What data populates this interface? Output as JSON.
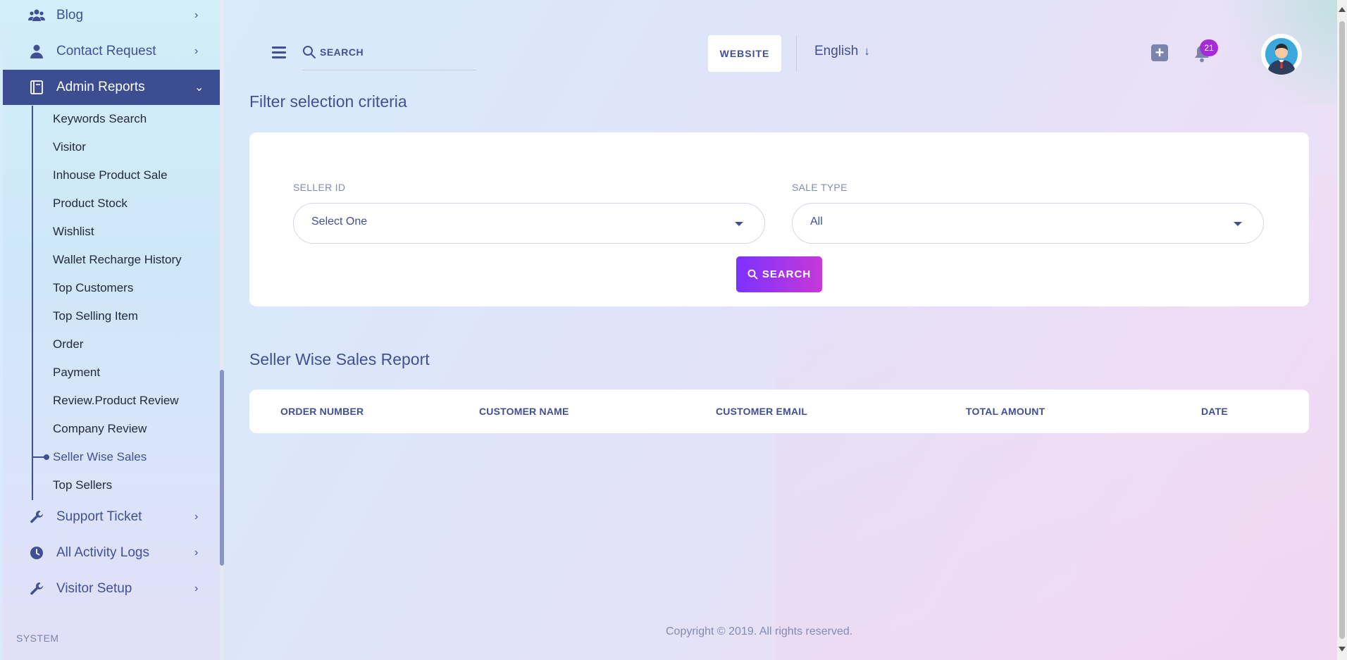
{
  "sidebar": {
    "top_items": [
      {
        "label": "Blog",
        "icon": "users-icon"
      },
      {
        "label": "Contact Request",
        "icon": "user-icon"
      },
      {
        "label": "Admin Reports",
        "icon": "book-icon"
      }
    ],
    "sub_items": [
      "Keywords Search",
      "Visitor",
      "Inhouse Product Sale",
      "Product Stock",
      "Wishlist",
      "Wallet Recharge History",
      "Top Customers",
      "Top Selling Item",
      "Order",
      "Payment",
      "Review.Product Review",
      "Company Review",
      "Seller Wise Sales",
      "Top Sellers"
    ],
    "active_sub_item": "Seller Wise Sales",
    "bottom_items": [
      {
        "label": "Support Ticket",
        "icon": "wrench-icon"
      },
      {
        "label": "All Activity Logs",
        "icon": "clock-icon"
      },
      {
        "label": "Visitor Setup",
        "icon": "wrench-icon"
      }
    ],
    "section_label": "SYSTEM"
  },
  "header": {
    "search_placeholder": "SEARCH",
    "website_label": "WEBSITE",
    "language": "English",
    "notification_count": "21"
  },
  "filter": {
    "title": "Filter selection criteria",
    "seller_label": "SELLER ID",
    "seller_value": "Select One",
    "sale_type_label": "SALE TYPE",
    "sale_type_value": "All",
    "search_button": "SEARCH"
  },
  "report": {
    "title": "Seller Wise Sales Report",
    "columns": [
      "ORDER NUMBER",
      "CUSTOMER NAME",
      "CUSTOMER EMAIL",
      "TOTAL AMOUNT",
      "DATE"
    ]
  },
  "footer": {
    "copyright": "Copyright © 2019. All rights reserved."
  },
  "colors": {
    "primary": "#415094",
    "active_menu": "#3c4d92",
    "button_gradient_start": "#7c32ff",
    "button_gradient_end": "#c738d8",
    "badge": "#a62bd8"
  }
}
